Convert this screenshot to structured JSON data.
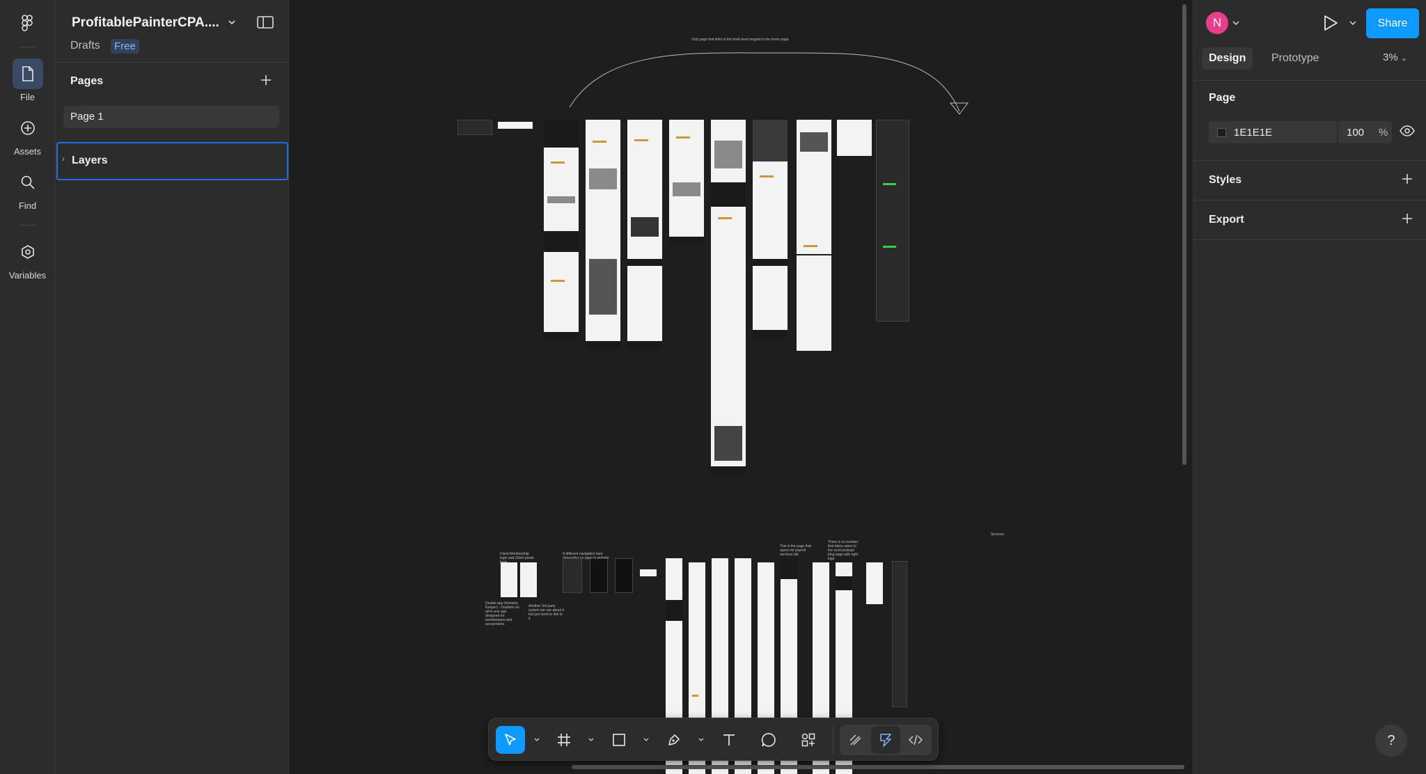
{
  "rail": {
    "items": [
      {
        "label": "File",
        "icon": "file-icon"
      },
      {
        "label": "Assets",
        "icon": "assets-icon"
      },
      {
        "label": "Find",
        "icon": "search-icon"
      },
      {
        "label": "Variables",
        "icon": "variables-icon"
      }
    ]
  },
  "file": {
    "title": "ProfitablePainterCPA....",
    "location": "Drafts",
    "plan_badge": "Free"
  },
  "pages": {
    "heading": "Pages",
    "items": [
      "Page 1"
    ]
  },
  "layers": {
    "heading": "Layers"
  },
  "canvas": {
    "background": "#1E1E1E",
    "notes": {
      "top": "Only page that links to the book level magnet is the home page",
      "services": "Services",
      "membership": "Client Membership login and Client portal login",
      "nav": "A different navigation bars depending on page in website",
      "payroll": "This is the page that opens for payroll services tab",
      "number": "There is no number that takes users to the scott podcast blog page with right logo",
      "double": "Double app (formerly Keeper) - Doubleis an all-in-one app designed for bookkeepers and accountants.",
      "third": "Another 3rd party system we use about it but just need to link to it"
    }
  },
  "toolbar": {
    "tools": [
      "move-tool",
      "frame-tool",
      "shape-tool",
      "pen-tool",
      "text-tool",
      "comment-tool",
      "actions-tool"
    ],
    "modes": [
      "draw-mode",
      "design-mode",
      "dev-mode"
    ]
  },
  "header": {
    "avatar_initial": "N",
    "share_label": "Share"
  },
  "inspector": {
    "tabs": [
      "Design",
      "Prototype"
    ],
    "zoom": "3%",
    "page_heading": "Page",
    "page_color": "1E1E1E",
    "page_opacity": "100",
    "opacity_unit": "%",
    "styles_heading": "Styles",
    "export_heading": "Export"
  },
  "help_label": "?",
  "colors": {
    "accent": "#0D99FF",
    "avatar": "#E83E8C",
    "panel": "#2C2C2C",
    "canvas": "#1E1E1E"
  }
}
